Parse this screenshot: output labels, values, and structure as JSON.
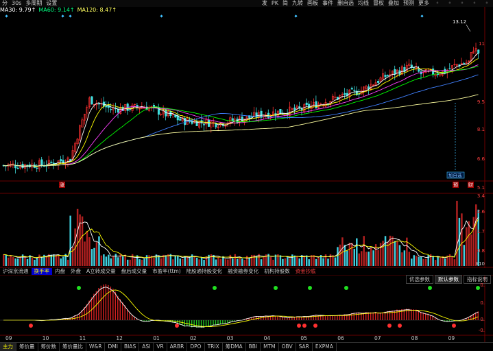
{
  "toolbar": {
    "left": [
      "分",
      "30s",
      "多周期",
      "设置"
    ],
    "right": [
      "发",
      "PK",
      "简",
      "九转",
      "画板",
      "事件",
      "删自选",
      "均线",
      "冒权",
      "叠加",
      "预测",
      "更多"
    ]
  },
  "ma_legend": [
    {
      "label": "MA30: 9.79↑",
      "color": "#ffffff"
    },
    {
      "label": "MA60: 9.14↑",
      "color": "#00ff80"
    },
    {
      "label": "MA120: 8.47↑",
      "color": "#ffff60"
    }
  ],
  "main_chart": {
    "price_ticks": [
      "11",
      "9.5",
      "8.1",
      "6.6",
      "5.1"
    ],
    "max_label": "13.12",
    "event_tag": "加自选",
    "badges": [
      "涨",
      "预",
      "财"
    ]
  },
  "volume_chart": {
    "ticks": [
      "3.4",
      "2.6",
      "1.7",
      "0.8",
      "X10"
    ]
  },
  "indicator_tabs": [
    "沪深京流通",
    "换手率",
    "内盘",
    "外盘",
    "A立转成交量",
    "盘后成交量",
    "市盈率(ttm)",
    "陆股通持股变化",
    "融资融券变化",
    "机构持股数",
    "资金抄底"
  ],
  "active_tab": "换手率",
  "indicator_controls": [
    "优选参数",
    "默认参数",
    "指标说明"
  ],
  "macd_ticks": [
    "0.",
    "0.",
    "0.",
    "-0."
  ],
  "x_axis": [
    "09",
    "10",
    "11",
    "12",
    "01",
    "02",
    "03",
    "04",
    "05",
    "06",
    "07",
    "08",
    "09"
  ],
  "bottom_tabs": [
    "主力",
    "筹价量",
    "筹价数",
    "筹价量比",
    "W&R",
    "DMI",
    "BIAS",
    "ASI",
    "VR",
    "ARBR",
    "DPO",
    "TRIX",
    "筹DMA",
    "BBI",
    "MTM",
    "OBV",
    "SAR",
    "EXPMA"
  ],
  "colors": {
    "up": "#ff3030",
    "down": "#40e0e0",
    "ma5": "#ffffff",
    "ma10": "#ffff00",
    "ma20": "#ff40ff",
    "ma30": "#00ff00",
    "ma60": "#4080ff",
    "ma120": "#ffffa0"
  }
}
